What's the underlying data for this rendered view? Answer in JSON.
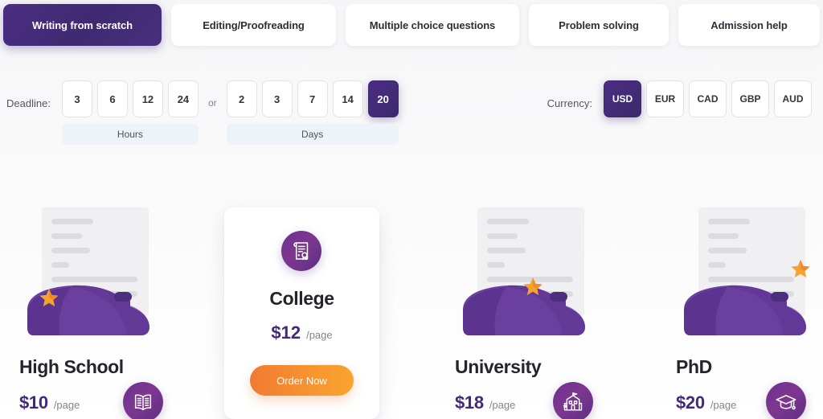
{
  "tabs": [
    {
      "label": "Writing from scratch",
      "active": true
    },
    {
      "label": "Editing/Proofreading",
      "active": false
    },
    {
      "label": "Multiple choice questions",
      "active": false
    },
    {
      "label": "Problem solving",
      "active": false
    },
    {
      "label": "Admission help",
      "active": false
    }
  ],
  "deadline": {
    "label": "Deadline:",
    "separator": "or",
    "hours": {
      "unit_label": "Hours",
      "options": [
        "3",
        "6",
        "12",
        "24"
      ],
      "selected": null
    },
    "days": {
      "unit_label": "Days",
      "options": [
        "2",
        "3",
        "7",
        "14",
        "20"
      ],
      "selected": "20"
    }
  },
  "currency": {
    "label": "Currency:",
    "options": [
      "USD",
      "EUR",
      "CAD",
      "GBP",
      "AUD"
    ],
    "selected": "USD"
  },
  "pricing": {
    "order_button_label": "Order Now",
    "cards": [
      {
        "title": "High School",
        "price": "$10",
        "per": "/page",
        "icon": "open-book-icon",
        "featured": false
      },
      {
        "title": "College",
        "price": "$12",
        "per": "/page",
        "icon": "certificate-icon",
        "featured": true
      },
      {
        "title": "University",
        "price": "$18",
        "per": "/page",
        "icon": "school-building-icon",
        "featured": false
      },
      {
        "title": "PhD",
        "price": "$20",
        "per": "/page",
        "icon": "graduation-cap-icon",
        "featured": false
      }
    ]
  },
  "colors": {
    "brand_purple": "#4b2d82",
    "price_purple": "#43297c",
    "accent_orange": "#f0812d",
    "badge_purple": "#6a3191",
    "page_bg": "#f6f6f8"
  }
}
